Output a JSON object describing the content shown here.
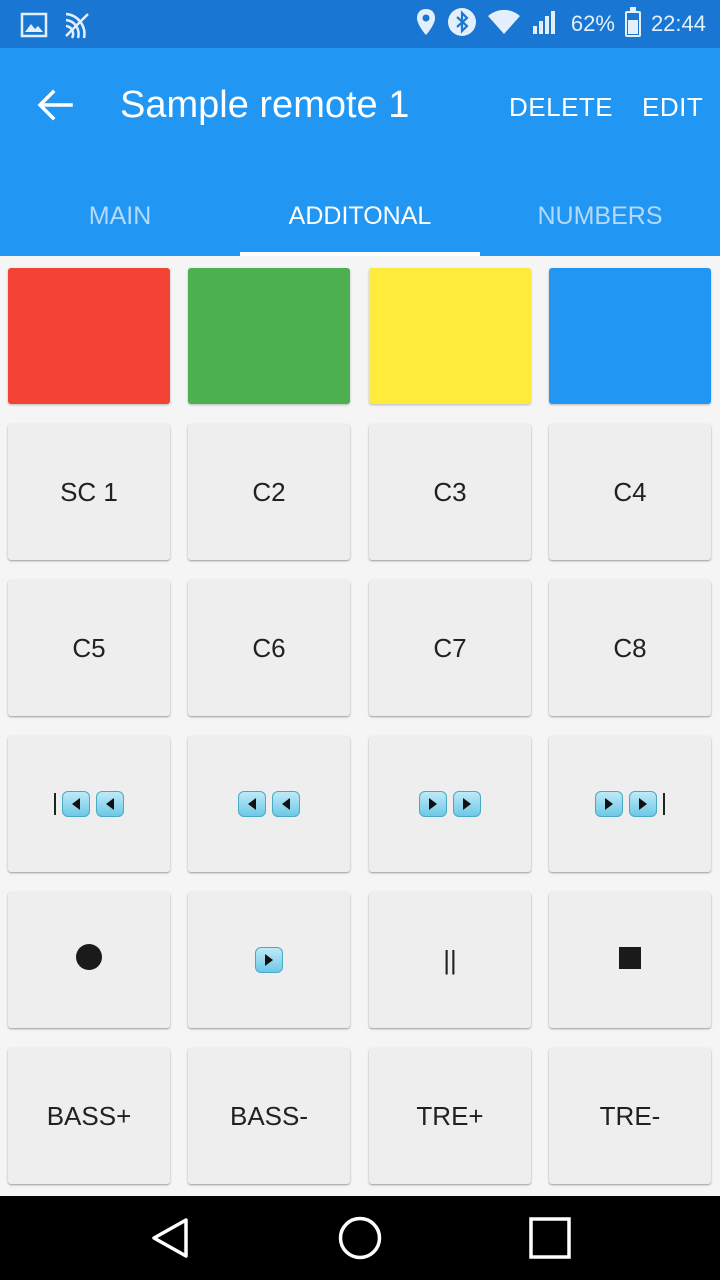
{
  "status_bar": {
    "battery_percent": "62%",
    "battery_level": 0.62,
    "time": "22:44",
    "icons": [
      "image-icon",
      "cast-icon",
      "location-icon",
      "bluetooth-icon",
      "wifi-icon",
      "signal-icon",
      "battery-icon"
    ]
  },
  "app_bar": {
    "title": "Sample remote 1",
    "delete_label": "DELETE",
    "edit_label": "EDIT",
    "color": "#2196f3"
  },
  "tabs": [
    {
      "label": "MAIN",
      "active": false
    },
    {
      "label": "ADDITONAL",
      "active": true
    },
    {
      "label": "NUMBERS",
      "active": false
    }
  ],
  "color_buttons": [
    {
      "name": "red",
      "color": "#f44336"
    },
    {
      "name": "green",
      "color": "#4caf50"
    },
    {
      "name": "yellow",
      "color": "#ffeb3b"
    },
    {
      "name": "blue",
      "color": "#2196f3"
    }
  ],
  "channel_buttons": [
    "SC 1",
    "C2",
    "C3",
    "C4",
    "C5",
    "C6",
    "C7",
    "C8"
  ],
  "media_buttons": [
    "skip-previous-icon",
    "rewind-icon",
    "fast-forward-icon",
    "skip-next-icon"
  ],
  "control_buttons": [
    "record-icon",
    "play-icon",
    "pause-icon",
    "stop-icon"
  ],
  "pause_glyph": "||",
  "audio_buttons": [
    "BASS+",
    "BASS-",
    "TRE+",
    "TRE-"
  ],
  "nav_bar": [
    "back-nav-icon",
    "home-nav-icon",
    "recents-nav-icon"
  ]
}
